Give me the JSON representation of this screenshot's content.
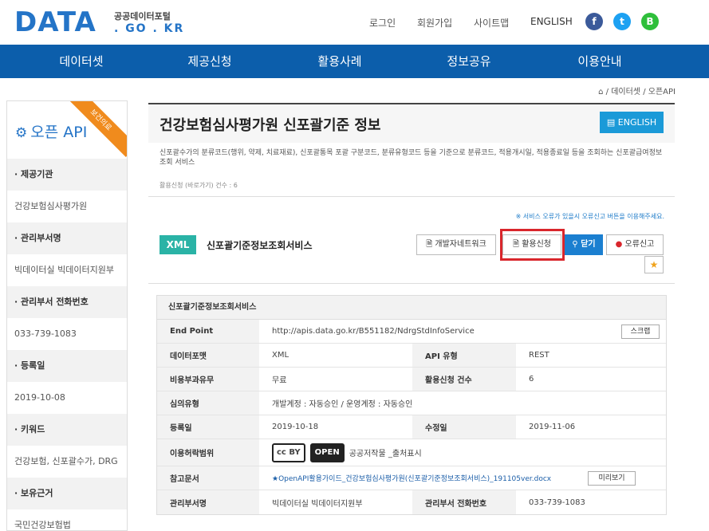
{
  "header": {
    "logo_main": "DATA",
    "logo_sub": "공공데이터포털",
    "logo_domain": ". GO . KR",
    "util_links": [
      "로그인",
      "회원가입",
      "사이트맵",
      "ENGLISH"
    ],
    "sns": [
      {
        "label": "f",
        "icon": "facebook-icon",
        "color": "#3b5a9a"
      },
      {
        "label": "t",
        "icon": "twitter-icon",
        "color": "#1da1f2"
      },
      {
        "label": "B",
        "icon": "blog-icon",
        "color": "#2fbf3b"
      }
    ]
  },
  "nav": {
    "items": [
      "데이터셋",
      "제공신청",
      "활용사례",
      "정보공유",
      "이용안내"
    ]
  },
  "breadcrumb": {
    "home_icon": "home-icon",
    "items": [
      "데이터셋",
      "오픈API"
    ]
  },
  "sidebar": {
    "title": "오픈 API",
    "ribbon": "보건의료",
    "rows": [
      {
        "label": "· 제공기관",
        "value": "건강보험심사평가원"
      },
      {
        "label": "· 관리부서명",
        "value": "빅데이터실 빅데이터지원부"
      },
      {
        "label": "· 관리부서 전화번호",
        "value": "033-739-1083"
      },
      {
        "label": "· 등록일",
        "value": "2019-10-08"
      },
      {
        "label": "· 키워드",
        "value": "건강보험, 신포괄수가, DRG"
      },
      {
        "label": "· 보유근거",
        "value": "국민건강보험법"
      }
    ]
  },
  "main": {
    "title": "건강보험심사평가원 신포괄기준 정보",
    "english_button": "ENGLISH",
    "description": "신포괄수가의 분류코드(행위, 약제, 치료재료), 신포괄통목 포괄 구분코드, 분류유형코드 등을 기준으로 분류코드, 적용개시일, 적용종료일 등을 조회하는 신포괄급여정보 조회 서비스",
    "apply_count": "활용신청 (바로가기) 건수 : 6",
    "notice": "※ 서비스 오류가 있을시 오류신고 버튼을 이용해주세요.",
    "service": {
      "badge": "XML",
      "name": "신포괄기준정보조회서비스",
      "buttons": {
        "dev_network": "개발자네트워크",
        "apply": "활용신청",
        "close": "닫기",
        "report": "오류신고",
        "star": "★"
      }
    }
  },
  "info_table": {
    "caption": "신포괄기준정보조회서비스",
    "endpoint_label": "End Point",
    "endpoint_value": "http://apis.data.go.kr/B551182/NdrgStdInfoService",
    "scrap": "스크랩",
    "format_label": "데이터포맷",
    "format_value": "XML",
    "api_type_label": "API 유형",
    "api_type_value": "REST",
    "fee_label": "비용부과유무",
    "fee_value": "무료",
    "apply_count_label": "활용신청 건수",
    "apply_count_value": "6",
    "review_label": "심의유형",
    "review_value": "개발계정 : 자동승인 / 운영계정 : 자동승인",
    "reg_date_label": "등록일",
    "reg_date_value": "2019-10-18",
    "mod_date_label": "수정일",
    "mod_date_value": "2019-11-06",
    "license_label": "이용허락범위",
    "license_cc": "cc BY",
    "license_open": "OPEN",
    "license_text": "공공저작물 _출처표시",
    "ref_doc_label": "참고문서",
    "ref_doc_value": "★OpenAPI활용가이드_건강보험심사평가원(신포괄기준정보조회서비스)_191105ver.docx",
    "preview": "미리보기",
    "dept_label": "관리부서명",
    "dept_value": "빅데이터실 빅데이터지원부",
    "dept_phone_label": "관리부서 전화번호",
    "dept_phone_value": "033-739-1083"
  }
}
